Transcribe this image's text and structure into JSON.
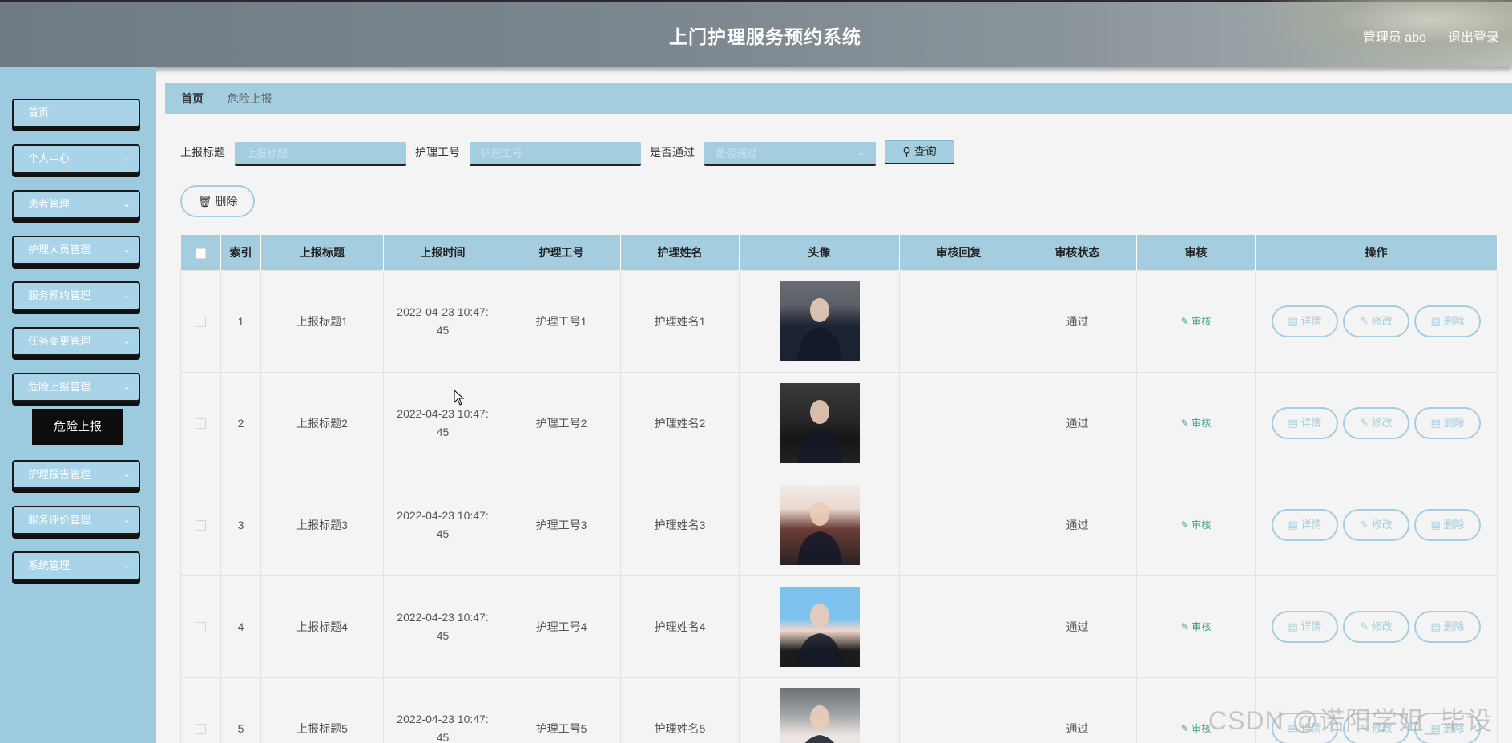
{
  "header": {
    "title": "上门护理服务预约系统",
    "user": "管理员 abo",
    "logout": "退出登录"
  },
  "sidebar": {
    "items": [
      {
        "label": "首页",
        "has_children": false
      },
      {
        "label": "个人中心",
        "has_children": true
      },
      {
        "label": "患者管理",
        "has_children": true
      },
      {
        "label": "护理人员管理",
        "has_children": true
      },
      {
        "label": "服务预约管理",
        "has_children": true
      },
      {
        "label": "任务变更管理",
        "has_children": true
      },
      {
        "label": "危险上报管理",
        "has_children": true
      },
      {
        "label": "护理报告管理",
        "has_children": true
      },
      {
        "label": "服务评价管理",
        "has_children": true
      },
      {
        "label": "系统管理",
        "has_children": true
      }
    ],
    "active_sub": "危险上报"
  },
  "breadcrumb": {
    "home": "首页",
    "current": "危险上报"
  },
  "search": {
    "title_label": "上报标题",
    "title_placeholder": "上报标题",
    "number_label": "护理工号",
    "number_placeholder": "护理工号",
    "passed_label": "是否通过",
    "passed_placeholder": "是否通过",
    "query_button": "查询"
  },
  "toolbar": {
    "delete_button": "删除"
  },
  "table": {
    "headers": [
      "索引",
      "上报标题",
      "上报时间",
      "护理工号",
      "护理姓名",
      "头像",
      "审核回复",
      "审核状态",
      "审核",
      "操作"
    ],
    "audit_label": "审核",
    "op_labels": {
      "detail": "详情",
      "edit": "修改",
      "delete": "删除"
    },
    "rows": [
      {
        "index": "1",
        "title": "上报标题1",
        "time1": "2022-04-23 10:47:",
        "time2": "45",
        "number": "护理工号1",
        "name": "护理姓名1",
        "reply": "",
        "status": "通过"
      },
      {
        "index": "2",
        "title": "上报标题2",
        "time1": "2022-04-23 10:47:",
        "time2": "45",
        "number": "护理工号2",
        "name": "护理姓名2",
        "reply": "",
        "status": "通过"
      },
      {
        "index": "3",
        "title": "上报标题3",
        "time1": "2022-04-23 10:47:",
        "time2": "45",
        "number": "护理工号3",
        "name": "护理姓名3",
        "reply": "",
        "status": "通过"
      },
      {
        "index": "4",
        "title": "上报标题4",
        "time1": "2022-04-23 10:47:",
        "time2": "45",
        "number": "护理工号4",
        "name": "护理姓名4",
        "reply": "",
        "status": "通过"
      },
      {
        "index": "5",
        "title": "上报标题5",
        "time1": "2022-04-23 10:47:",
        "time2": "45",
        "number": "护理工号5",
        "name": "护理姓名5",
        "reply": "",
        "status": "通过"
      }
    ]
  },
  "watermark": "CSDN @诺阳学姐_毕设",
  "colors": {
    "accent": "#a4cde0",
    "sidebar": "#9ccbe0",
    "audit_link": "#3a9d8f"
  }
}
